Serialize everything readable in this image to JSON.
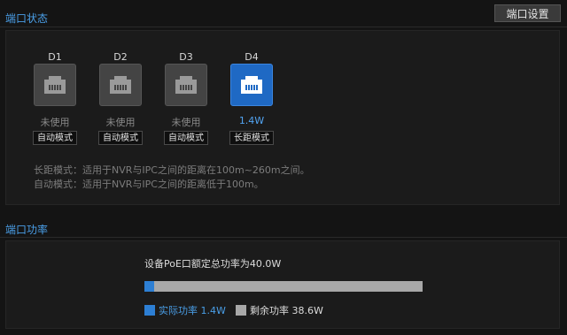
{
  "header": {
    "title": "端口状态",
    "settings_button": "端口设置"
  },
  "ports": [
    {
      "name": "D1",
      "status": "未使用",
      "mode": "自动模式",
      "active": false
    },
    {
      "name": "D2",
      "status": "未使用",
      "mode": "自动模式",
      "active": false
    },
    {
      "name": "D3",
      "status": "未使用",
      "mode": "自动模式",
      "active": false
    },
    {
      "name": "D4",
      "status": "1.4W",
      "mode": "长距模式",
      "active": true
    }
  ],
  "notes": {
    "long_distance": "长距模式：适用于NVR与IPC之间的距离在100m~260m之间。",
    "auto": "自动模式：适用于NVR与IPC之间的距离低于100m。"
  },
  "power": {
    "section_title": "端口功率",
    "total_label": "设备PoE口额定总功率为40.0W",
    "actual_label": "实际功率 1.4W",
    "remaining_label": "剩余功率 38.6W",
    "actual_fraction": 0.035,
    "colors": {
      "actual": "#2d7fd4",
      "remaining": "#a8a8a8",
      "accent": "#4a9fe8"
    }
  }
}
